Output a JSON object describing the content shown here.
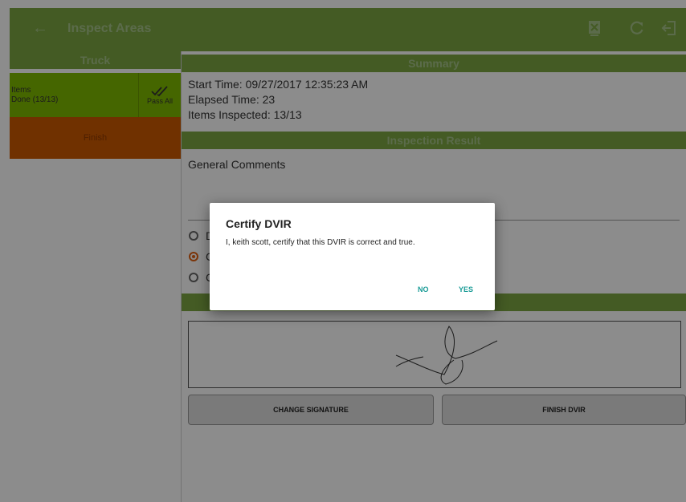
{
  "appbar": {
    "title": "Inspect Areas",
    "back_icon": "arrow-left-icon",
    "action_icons": [
      "cancel-document-icon",
      "refresh-icon",
      "logout-icon"
    ],
    "color": "#7ca642"
  },
  "sidebar": {
    "header": "Truck",
    "item": {
      "label": "Items",
      "status": "Done (13/13)",
      "pass_all": "Pass All"
    },
    "finish": "Finish",
    "colors": {
      "item_bg": "#7fba00",
      "finish_bg": "#cc5a00"
    }
  },
  "summary": {
    "header": "Summary",
    "start_time": "Start Time: 09/27/2017 12:35:23 AM",
    "elapsed_time": "Elapsed Time: 23",
    "items_inspected": "Items Inspected: 13/13"
  },
  "inspection_result": {
    "header": "Inspection Result",
    "comments_label": "General Comments",
    "radio_prefixes": [
      "D",
      "C",
      "C"
    ],
    "selected_index": 1
  },
  "buttons": {
    "change_signature": "CHANGE SIGNATURE",
    "finish_dvir": "FINISH DVIR"
  },
  "dialog": {
    "title": "Certify DVIR",
    "message": "I, keith scott, certify that this DVIR is correct and true.",
    "no": "NO",
    "yes": "YES",
    "accent": "#1a9c97"
  }
}
